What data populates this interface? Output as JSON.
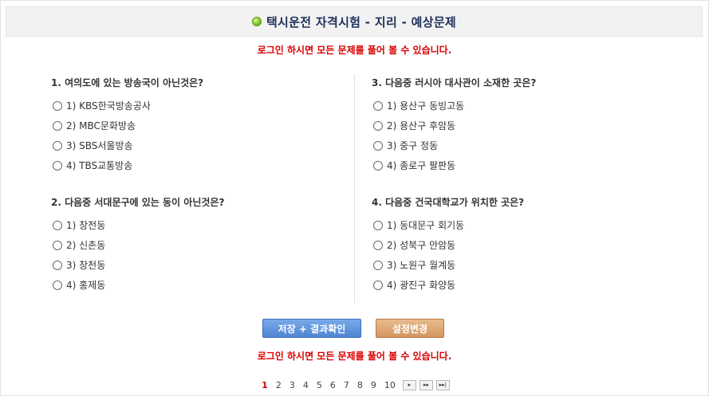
{
  "header": {
    "title": "택시운전 자격시험 - 지리 - 예상문제"
  },
  "notice_top": "로그인 하시면 모든 문제를 풀어 볼 수 있습니다.",
  "left_questions": [
    {
      "title": "1. 여의도에 있는 방송국이 아닌것은?",
      "options": [
        "1) KBS한국방송공사",
        "2) MBC문화방송",
        "3) SBS서울방송",
        "4) TBS교통방송"
      ]
    },
    {
      "title": "2. 다음중 서대문구에 있는 동이 아닌것은?",
      "options": [
        "1) 창전동",
        "2) 신촌동",
        "3) 창천동",
        "4) 홍제동"
      ]
    }
  ],
  "right_questions": [
    {
      "title": "3. 다음중 러시아 대사관이 소재한 곳은?",
      "options": [
        "1) 용산구 동빙고동",
        "2) 용산구 후암동",
        "3) 중구 정동",
        "4) 종로구 팔판동"
      ]
    },
    {
      "title": "4. 다음중 건국대학교가 위치한 곳은?",
      "options": [
        "1) 동대문구 회기동",
        "2) 성북구 안암동",
        "3) 노원구 월계동",
        "4) 광진구 화양동"
      ]
    }
  ],
  "buttons": {
    "save": "저장 + 결과확인",
    "settings": "설정변경"
  },
  "notice_bottom": "로그인 하시면 모든 문제를 풀어 볼 수 있습니다.",
  "pagination": {
    "pages": [
      "1",
      "2",
      "3",
      "4",
      "5",
      "6",
      "7",
      "8",
      "9",
      "10"
    ],
    "current": "1",
    "nav": [
      "▸",
      "▸▸",
      "▸▸|"
    ]
  }
}
